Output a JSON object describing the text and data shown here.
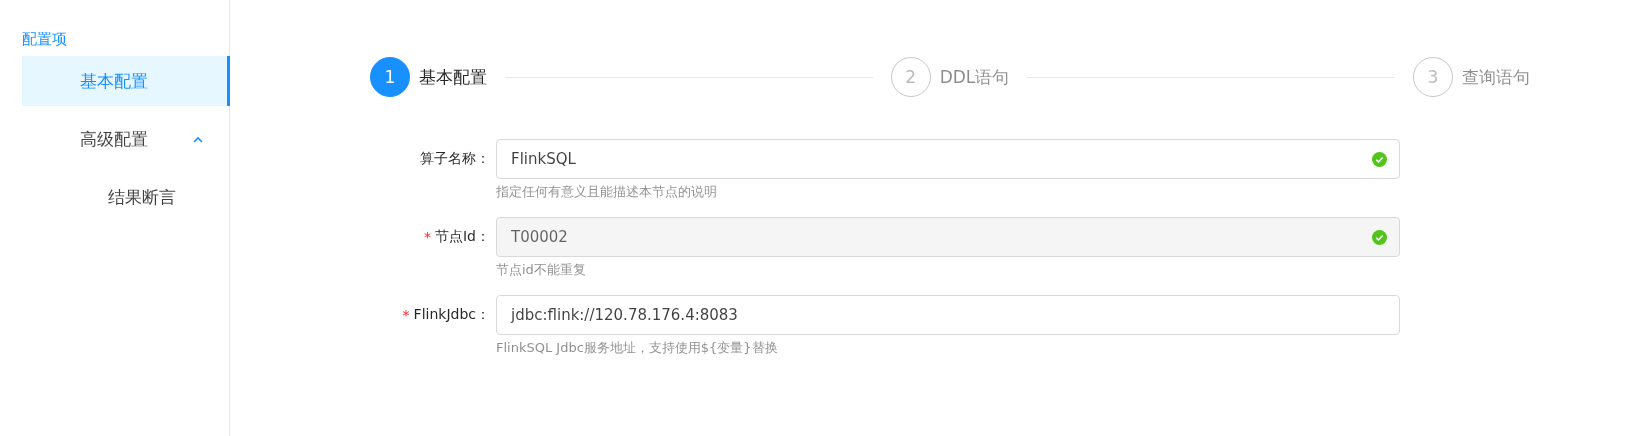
{
  "sidebar": {
    "title": "配置项",
    "items": [
      {
        "label": "基本配置",
        "selected": true
      },
      {
        "label": "高级配置",
        "selected": false,
        "expanded": true,
        "children": [
          {
            "label": "结果断言",
            "selected": false
          }
        ]
      }
    ]
  },
  "steps": [
    {
      "number": "1",
      "title": "基本配置",
      "selected": true
    },
    {
      "number": "2",
      "title": "DDL语句",
      "selected": false
    },
    {
      "number": "3",
      "title": "查询语句",
      "selected": false
    }
  ],
  "form": [
    {
      "label": "算子名称：",
      "value": "FlinkSQL",
      "disabled": false,
      "valid": true,
      "help": "指定任何有意义且能描述本节点的说明"
    },
    {
      "label": "节点Id：",
      "required_mark": "*",
      "value": "T00002",
      "disabled": true,
      "valid": true,
      "help": "节点id不能重复"
    },
    {
      "label": "FlinkJdbc：",
      "required_mark": "*",
      "value": "jdbc:flink://120.78.176.4:8083",
      "disabled": false,
      "valid": false,
      "help": "FlinkSQL Jdbc服务地址，支持使用${变量}替换"
    }
  ]
}
